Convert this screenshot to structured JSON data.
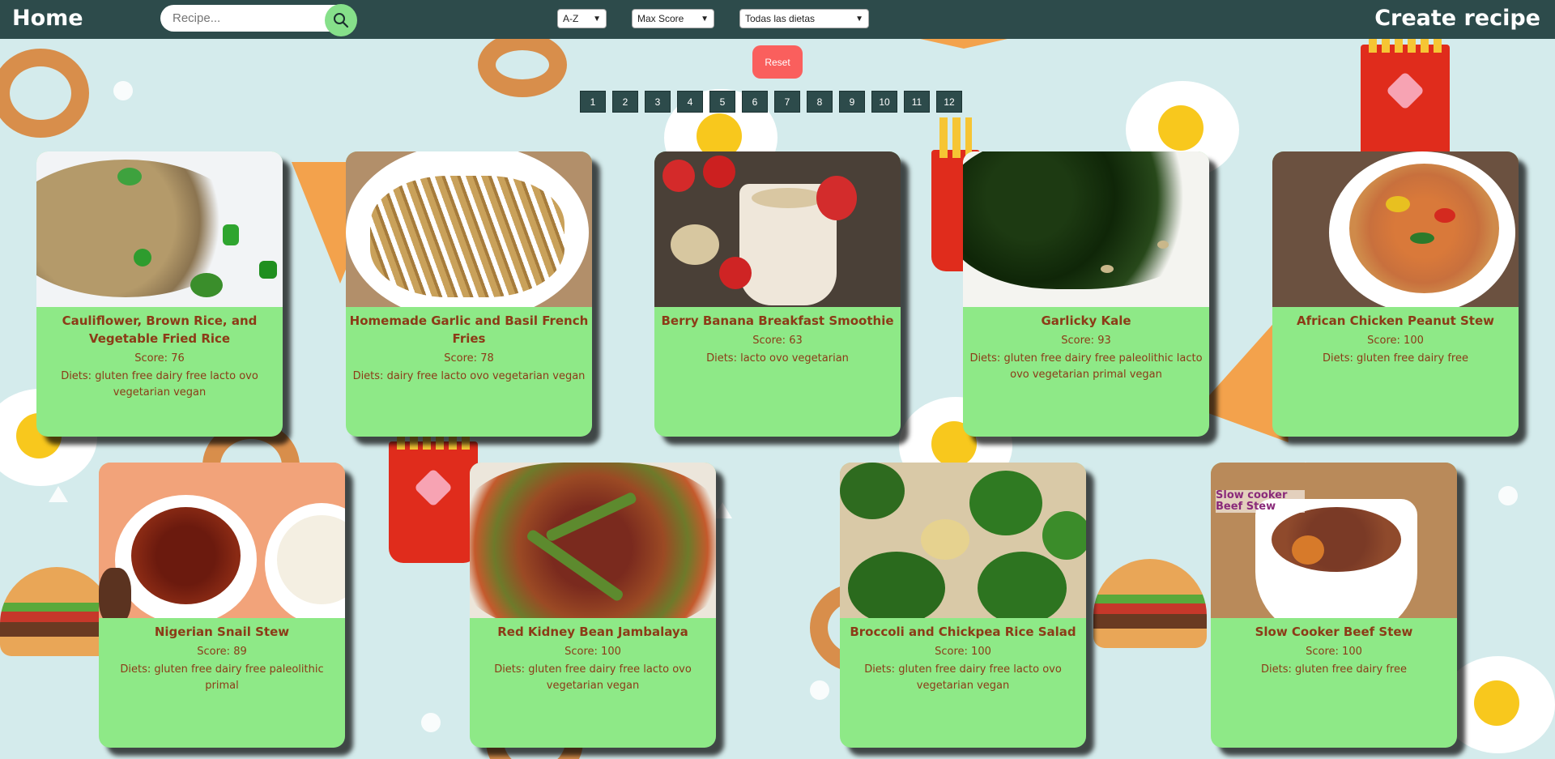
{
  "navbar": {
    "home_label": "Home",
    "create_label": "Create recipe",
    "search_placeholder": "Recipe...",
    "sort_alpha": "A-Z",
    "sort_score": "Max Score",
    "diet_filter": "Todas las dietas"
  },
  "reset_label": "Reset",
  "pages": [
    "1",
    "2",
    "3",
    "4",
    "5",
    "6",
    "7",
    "8",
    "9",
    "10",
    "11",
    "12"
  ],
  "recipes": [
    {
      "title": "Cauliflower, Brown Rice, and Vegetable Fried Rice",
      "score": "Score: 76",
      "diets": "Diets: gluten free dairy free lacto ovo vegetarian vegan"
    },
    {
      "title": "Homemade Garlic and Basil French Fries",
      "score": "Score: 78",
      "diets": "Diets: dairy free lacto ovo vegetarian vegan"
    },
    {
      "title": "Berry Banana Breakfast Smoothie",
      "score": "Score: 63",
      "diets": "Diets: lacto ovo vegetarian"
    },
    {
      "title": "Garlicky Kale",
      "score": "Score: 93",
      "diets": "Diets: gluten free dairy free paleolithic lacto ovo vegetarian primal vegan"
    },
    {
      "title": "African Chicken Peanut Stew",
      "score": "Score: 100",
      "diets": "Diets: gluten free dairy free"
    },
    {
      "title": "Nigerian Snail Stew",
      "score": "Score: 89",
      "diets": "Diets: gluten free dairy free paleolithic primal"
    },
    {
      "title": "Red Kidney Bean Jambalaya",
      "score": "Score: 100",
      "diets": "Diets: gluten free dairy free lacto ovo vegetarian vegan"
    },
    {
      "title": "Broccoli and Chickpea Rice Salad",
      "score": "Score: 100",
      "diets": "Diets: gluten free dairy free lacto ovo vegetarian vegan"
    },
    {
      "title": "Slow Cooker Beef Stew",
      "score": "Score: 100",
      "diets": "Diets: gluten free dairy free",
      "image_text": "Slow cooker Beef Stew"
    }
  ]
}
